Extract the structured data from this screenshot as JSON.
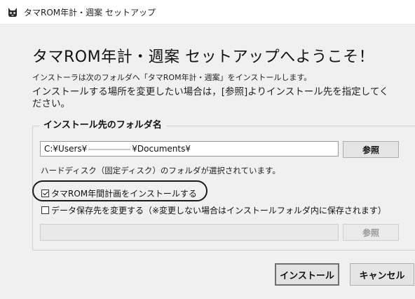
{
  "window": {
    "title": "タマROM年計・週案 セットアップ",
    "icon": "cat-face-icon"
  },
  "heading": "タマROM年計・週案 セットアップへようこそ！",
  "intro": {
    "line1": "インストーラは次のフォルダへ「タマROM年計・週案」をインストールします。",
    "line2": "インストールする場所を変更したい場合は，[参照]よりインストール先を指定してください。"
  },
  "install_folder": {
    "group_label": "インストール先のフォルダ名",
    "path_prefix": "C:¥Users¥",
    "path_suffix": "¥Documents¥",
    "browse_label": "参照",
    "hint": "ハードディスク（固定ディスク）のフォルダが選択されています。"
  },
  "options": {
    "install_annual_plan": {
      "label": "タマROM年間計画をインストールする",
      "checked": true
    },
    "change_data_location": {
      "label": "データ保存先を変更する（※変更しない場合はインストールフォルダ内に保存されます）",
      "checked": false
    },
    "data_path_value": "",
    "data_browse_label": "参照"
  },
  "buttons": {
    "install": "インストール",
    "cancel": "キャンセル"
  },
  "colors": {
    "background": "#f0f0f0",
    "highlight_ring": "#1a1a1a"
  }
}
